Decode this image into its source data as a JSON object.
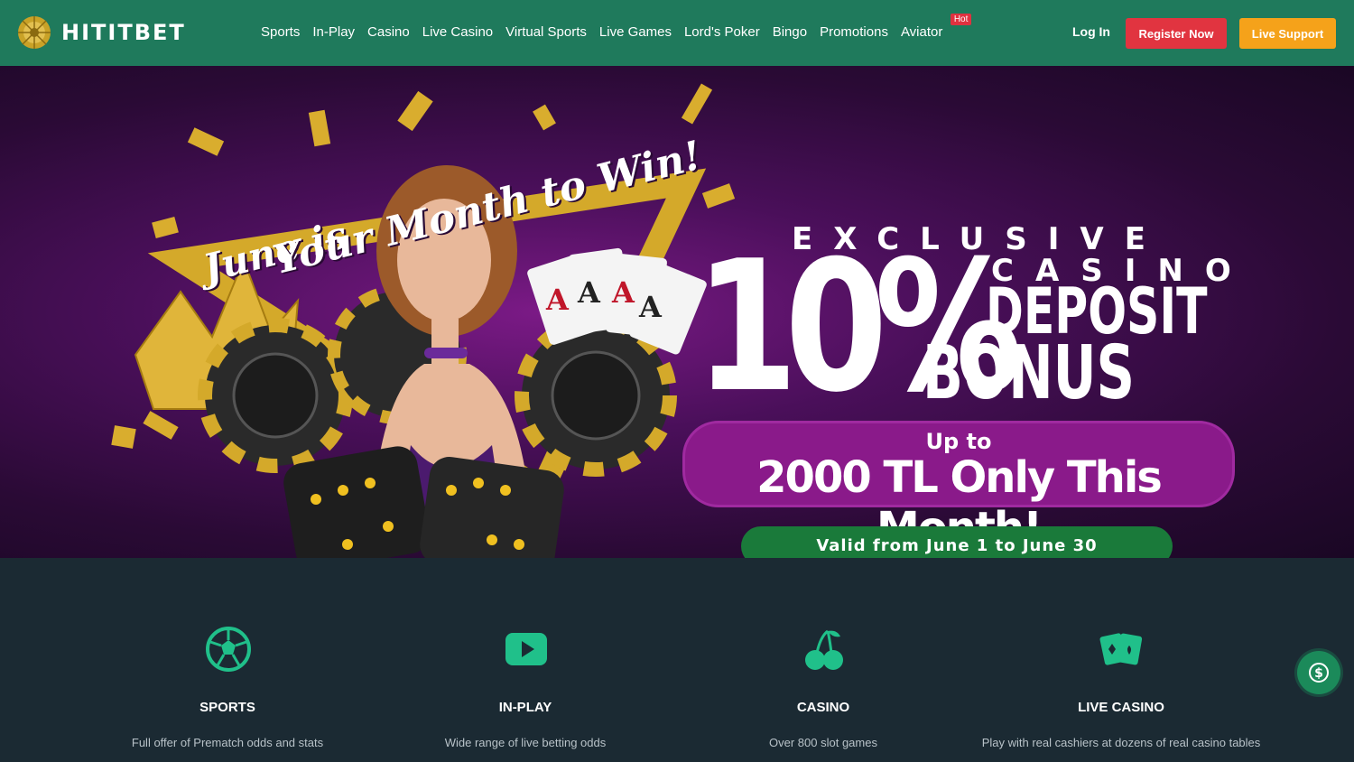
{
  "brand": {
    "name": "HITITBET"
  },
  "nav": {
    "items": [
      "Sports",
      "In-Play",
      "Casino",
      "Live Casino",
      "Virtual Sports",
      "Live Games",
      "Lord's Poker",
      "Bingo",
      "Promotions",
      "Aviator"
    ],
    "aviator_badge": "Hot"
  },
  "header": {
    "login": "Log In",
    "register": "Register Now",
    "support": "Live Support"
  },
  "hero": {
    "line1": "June is",
    "line2": "Your Month to Win!",
    "exclusive": "EXCLUSIVE",
    "casino": "CASINO",
    "percent": "10%",
    "deposit": "DEPOSIT",
    "bonus": "BONUS",
    "upto": "Up to",
    "amount": "2000 TL Only This Month!",
    "valid": "Valid from June 1 to June 30",
    "slide_count": 10,
    "active_slide": 1
  },
  "features": [
    {
      "title": "SPORTS",
      "desc": "Full offer of Prematch odds and stats",
      "icon": "soccer-ball-icon"
    },
    {
      "title": "IN-PLAY",
      "desc": "Wide range of live betting odds",
      "icon": "play-icon"
    },
    {
      "title": "CASINO",
      "desc": "Over 800 slot games",
      "icon": "cherry-icon"
    },
    {
      "title": "LIVE CASINO",
      "desc": "Play with real cashiers at dozens of real casino tables",
      "icon": "cards-icon"
    }
  ],
  "colors": {
    "header_bg": "#1f7a5c",
    "accent_green": "#20c08a",
    "register_red": "#e13440",
    "support_orange": "#f5a21a",
    "page_bg": "#1b2a33"
  }
}
